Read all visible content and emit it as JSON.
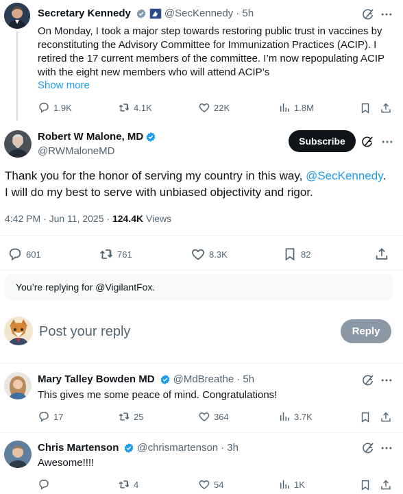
{
  "thread_parent": {
    "name": "Secretary Kennedy",
    "handle": "@SecKennedy",
    "time": "· 5h",
    "text": "On Monday, I took a major step towards restoring public trust in vaccines by reconstituting the Advisory Committee for Immunization Practices (ACIP). I retired the 17 current members of the committee. I’m now repopulating ACIP with the eight new members who will attend ACIP’s",
    "show_more": "Show more",
    "replies": "1.9K",
    "reposts": "4.1K",
    "likes": "22K",
    "views": "1.8M"
  },
  "main_post": {
    "name": "Robert W Malone, MD",
    "handle": "@RWMaloneMD",
    "subscribe_label": "Subscribe",
    "text_before": "Thank you for the honor of serving my country in this way, ",
    "mention": "@SecKennedy",
    "text_after": ".\nI will do my best to serve with unbiased objectivity and rigor.",
    "timestamp": "4:42 PM · Jun 11, 2025 · ",
    "views_count": "124.4K",
    "views_label": " Views",
    "replies": "601",
    "reposts": "761",
    "likes": "8.3K",
    "bookmarks": "82"
  },
  "replying_notice": "You’re replying for @VigilantFox.",
  "composer": {
    "placeholder": "Post your reply",
    "reply_label": "Reply"
  },
  "replies": [
    {
      "name": "Mary Talley Bowden MD",
      "handle": "@MdBreathe",
      "time": "· 5h",
      "text": "This gives me some peace of mind. Congratulations!",
      "replies": "17",
      "reposts": "25",
      "likes": "364",
      "views": "3.7K"
    },
    {
      "name": "Chris Martenson",
      "handle": "@chrismartenson",
      "time": "· 3h",
      "text": "Awesome!!!!",
      "replies": "",
      "reposts": "4",
      "likes": "54",
      "views": "1K"
    }
  ],
  "colors": {
    "accent": "#1d9bf0",
    "text": "#0f1419",
    "muted": "#536471",
    "notice_bg": "#f7f9f9",
    "reply_button_bg": "#8b98a5"
  }
}
